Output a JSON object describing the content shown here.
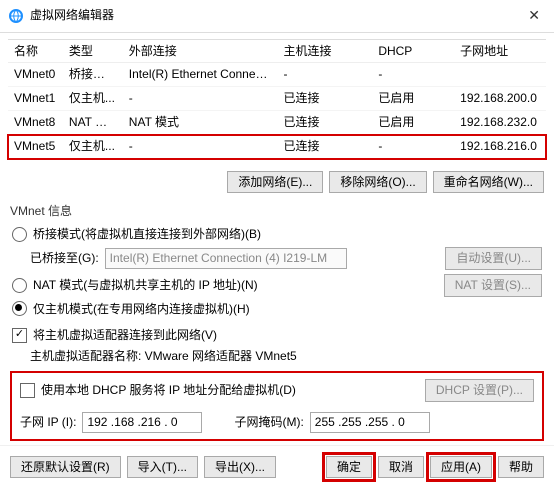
{
  "window": {
    "title": "虚拟网络编辑器",
    "close": "✕"
  },
  "table": {
    "headers": {
      "name": "名称",
      "type": "类型",
      "ext": "外部连接",
      "host": "主机连接",
      "dhcp": "DHCP",
      "subnet": "子网地址"
    },
    "rows": [
      {
        "name": "VMnet0",
        "type": "桥接模式",
        "ext": "Intel(R) Ethernet Connection (...",
        "host": "-",
        "dhcp": "-",
        "subnet": ""
      },
      {
        "name": "VMnet1",
        "type": "仅主机...",
        "ext": "-",
        "host": "已连接",
        "dhcp": "已启用",
        "subnet": "192.168.200.0"
      },
      {
        "name": "VMnet8",
        "type": "NAT 模式",
        "ext": "NAT 模式",
        "host": "已连接",
        "dhcp": "已启用",
        "subnet": "192.168.232.0"
      },
      {
        "name": "VMnet5",
        "type": "仅主机...",
        "ext": "-",
        "host": "已连接",
        "dhcp": "-",
        "subnet": "192.168.216.0"
      }
    ]
  },
  "buttons": {
    "add": "添加网络(E)...",
    "remove": "移除网络(O)...",
    "rename": "重命名网络(W)..."
  },
  "info": {
    "title": "VMnet 信息",
    "bridge_label": "桥接模式(将虚拟机直接连接到外部网络)(B)",
    "bridge_to": "已桥接至(G):",
    "bridge_sel": "Intel(R) Ethernet Connection (4) I219-LM",
    "auto": "自动设置(U)...",
    "nat_label": "NAT 模式(与虚拟机共享主机的 IP 地址)(N)",
    "nat_btn": "NAT 设置(S)...",
    "host_label": "仅主机模式(在专用网络内连接虚拟机)(H)",
    "hostadp": "将主机虚拟适配器连接到此网络(V)",
    "hostadp_name": "主机虚拟适配器名称: VMware 网络适配器 VMnet5",
    "dhcp_label": "使用本地 DHCP 服务将 IP 地址分配给虚拟机(D)",
    "dhcp_btn": "DHCP 设置(P)...",
    "subnet_label": "子网 IP (I):",
    "subnet_val": "192 .168 .216 . 0",
    "mask_label": "子网掩码(M):",
    "mask_val": "255 .255 .255 . 0"
  },
  "footer": {
    "restore": "还原默认设置(R)",
    "import": "导入(T)...",
    "export": "导出(X)...",
    "ok": "确定",
    "cancel": "取消",
    "apply": "应用(A)",
    "help": "帮助"
  }
}
